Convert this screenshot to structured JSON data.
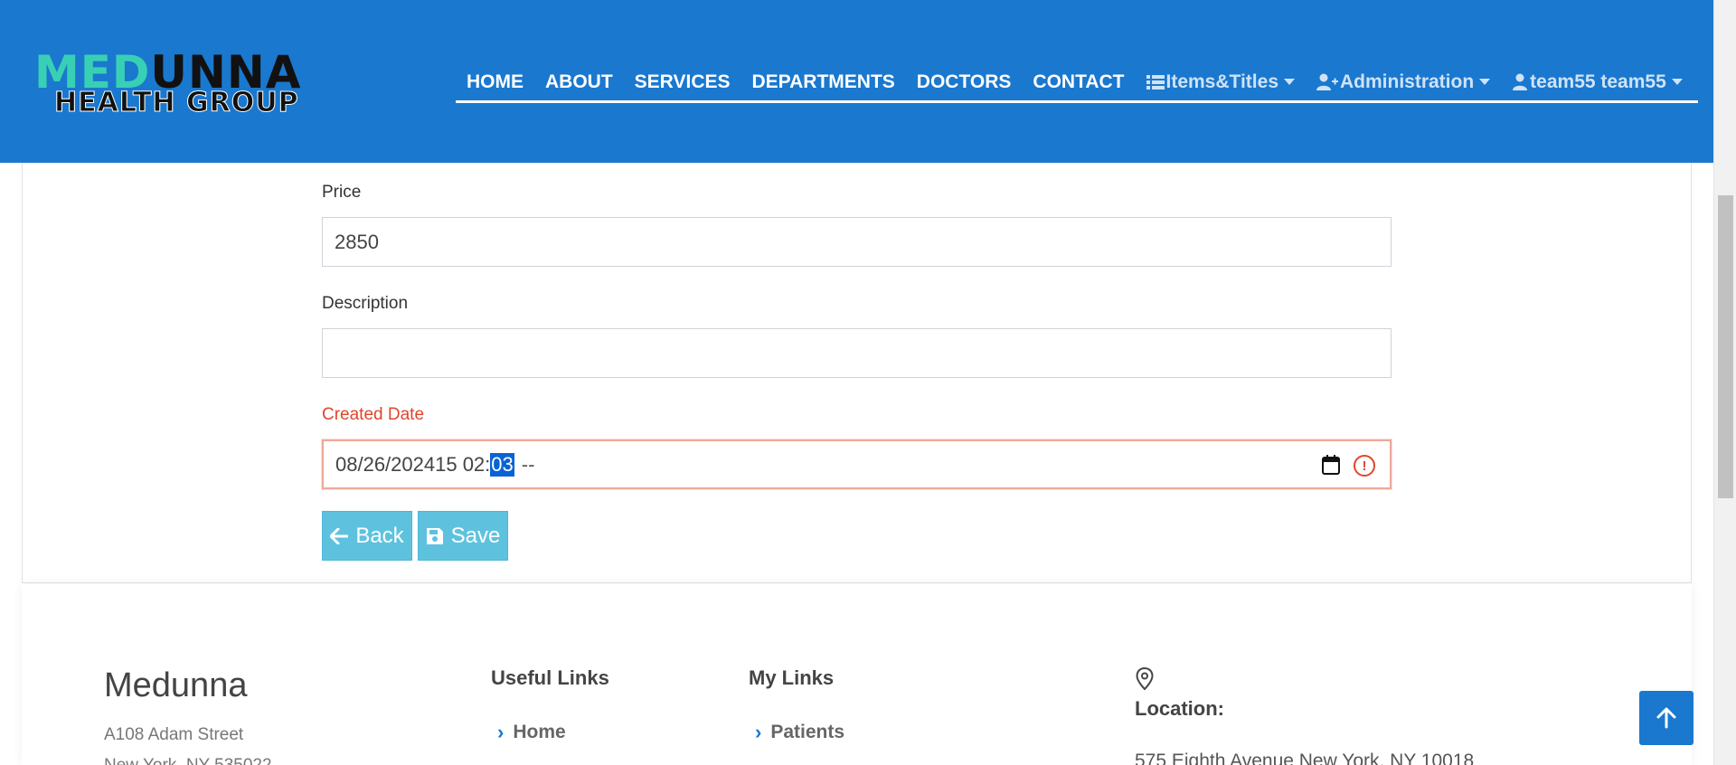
{
  "header": {
    "logo": {
      "part1": "MED",
      "part2": "UNNA",
      "subtitle": "HEALTH GROUP"
    },
    "nav": [
      {
        "label": "HOME"
      },
      {
        "label": "ABOUT"
      },
      {
        "label": "SERVICES"
      },
      {
        "label": "DEPARTMENTS"
      },
      {
        "label": "DOCTORS"
      },
      {
        "label": "CONTACT"
      },
      {
        "label": "Items&Titles",
        "icon": "list-icon",
        "dropdown": true
      },
      {
        "label": "Administration",
        "icon": "user-plus-icon",
        "dropdown": true
      },
      {
        "label": "team55 team55",
        "icon": "user-icon",
        "dropdown": true
      }
    ]
  },
  "form": {
    "price": {
      "label": "Price",
      "value": "2850"
    },
    "description": {
      "label": "Description",
      "value": ""
    },
    "created_date": {
      "label": "Created Date",
      "value_before": "08/26/202415 02:",
      "value_selected": "03",
      "value_after": "--",
      "state": "error"
    },
    "back_label": "Back",
    "save_label": "Save"
  },
  "footer": {
    "brand": "Medunna",
    "address_line1": "A108 Adam Street",
    "address_line2": "New York, NY 535022",
    "useful_links": {
      "title": "Useful Links",
      "items": [
        "Home"
      ]
    },
    "my_links": {
      "title": "My Links",
      "items": [
        "Patients"
      ]
    },
    "location": {
      "label": "Location:",
      "address": "575 Eighth Avenue New York, NY 10018"
    }
  },
  "colors": {
    "header_bg": "#1a78cf",
    "logo_accent": "#38d0b4",
    "button_bg": "#5ec2df",
    "error": "#e0452b",
    "selection": "#0a63d4"
  }
}
